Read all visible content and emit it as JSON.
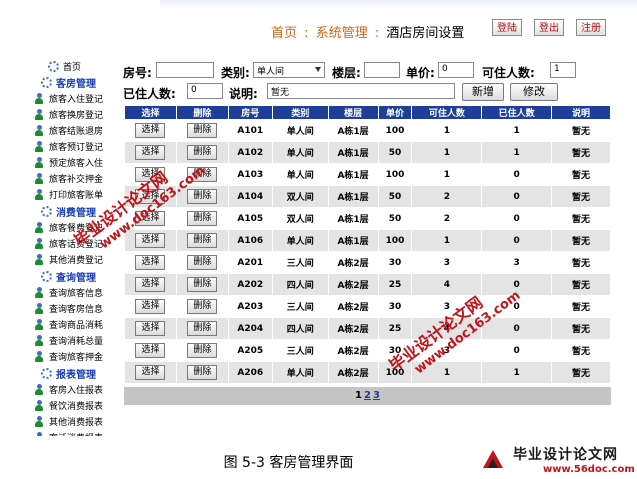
{
  "header": {
    "crumb_home": "首页",
    "crumb_sep1": ":",
    "crumb_system": "系统管理",
    "crumb_sep2": ":",
    "crumb_current": "酒店房间设置",
    "btn_login": "登陆",
    "btn_logout": "登出",
    "btn_register": "注册"
  },
  "sidebar": {
    "home": "首页",
    "room_mgmt": "客房管理",
    "room_items": [
      "旅客入住登记",
      "旅客换房登记",
      "旅客结账退房",
      "旅客预订登记",
      "预定旅客入住",
      "旅客补交押金",
      "打印旅客账单"
    ],
    "consume_mgmt": "消费管理",
    "consume_items": [
      "旅客餐费登记",
      "旅客话费登记",
      "其他消费登记"
    ],
    "query_mgmt": "查询管理",
    "query_items": [
      "查询旅客信息",
      "查询客房信息",
      "查询商品消耗",
      "查询消耗总量",
      "查询旅客押金"
    ],
    "report_mgmt": "报表管理",
    "report_items": [
      "客房入住报表",
      "餐饮消费报表",
      "其他消费报表",
      "客话消费报表"
    ]
  },
  "form": {
    "room_no_label": "房号:",
    "room_no_value": "",
    "type_label": "类别:",
    "type_value": "单人间",
    "floor_label": "楼层:",
    "floor_value": "",
    "price_label": "单价:",
    "price_value": "0",
    "capacity_label": "可住人数:",
    "capacity_value": "1",
    "occupied_label": "已住人数:",
    "occupied_value": "0",
    "note_label": "说明:",
    "note_value": "暂无",
    "add_button": "新增",
    "edit_button": "修改"
  },
  "table": {
    "headers": [
      "选择",
      "删除",
      "房号",
      "类别",
      "楼层",
      "单价",
      "可住人数",
      "已住人数",
      "说明"
    ],
    "select_label": "选择",
    "delete_label": "删除",
    "rows": [
      {
        "room": "A101",
        "type": "单人间",
        "floor": "A栋1层",
        "price": "100",
        "cap": "1",
        "occ": "1",
        "note": "暂无"
      },
      {
        "room": "A102",
        "type": "单人间",
        "floor": "A栋1层",
        "price": "50",
        "cap": "1",
        "occ": "1",
        "note": "暂无"
      },
      {
        "room": "A103",
        "type": "单人间",
        "floor": "A栋1层",
        "price": "100",
        "cap": "1",
        "occ": "0",
        "note": "暂无"
      },
      {
        "room": "A104",
        "type": "双人间",
        "floor": "A栋1层",
        "price": "50",
        "cap": "2",
        "occ": "0",
        "note": "暂无"
      },
      {
        "room": "A105",
        "type": "双人间",
        "floor": "A栋1层",
        "price": "50",
        "cap": "2",
        "occ": "0",
        "note": "暂无"
      },
      {
        "room": "A106",
        "type": "单人间",
        "floor": "A栋1层",
        "price": "100",
        "cap": "1",
        "occ": "0",
        "note": "暂无"
      },
      {
        "room": "A201",
        "type": "三人间",
        "floor": "A栋2层",
        "price": "30",
        "cap": "3",
        "occ": "3",
        "note": "暂无"
      },
      {
        "room": "A202",
        "type": "四人间",
        "floor": "A栋2层",
        "price": "25",
        "cap": "4",
        "occ": "0",
        "note": "暂无"
      },
      {
        "room": "A203",
        "type": "三人间",
        "floor": "A栋2层",
        "price": "30",
        "cap": "3",
        "occ": "0",
        "note": "暂无"
      },
      {
        "room": "A204",
        "type": "四人间",
        "floor": "A栋2层",
        "price": "25",
        "cap": "4",
        "occ": "0",
        "note": "暂无"
      },
      {
        "room": "A205",
        "type": "三人间",
        "floor": "A栋2层",
        "price": "30",
        "cap": "3",
        "occ": "0",
        "note": "暂无"
      },
      {
        "room": "A206",
        "type": "单人间",
        "floor": "A栋2层",
        "price": "100",
        "cap": "1",
        "occ": "1",
        "note": "暂无"
      }
    ]
  },
  "pager": {
    "pages": [
      "1",
      "2",
      "3"
    ]
  },
  "watermark": {
    "line1": "毕业设计论文网",
    "line2": "www.doc163.com"
  },
  "caption": "图 5-3 客房管理界面",
  "brand": {
    "name": "毕业设计论文网",
    "url": "www.56doc.com"
  },
  "colors": {
    "header_bar": "#1d3f9a",
    "row_alt": "#e4e4e4",
    "crumb_link": "#d0661a",
    "sidebar_head": "#1a3fb5",
    "watermark": "#c0151a"
  }
}
